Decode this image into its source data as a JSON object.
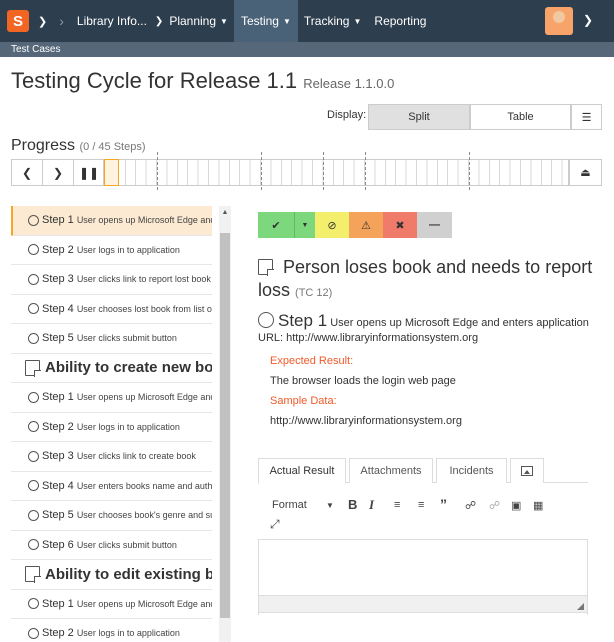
{
  "nav": {
    "logo": "S",
    "items": [
      {
        "label": "Library Info..."
      },
      {
        "label": "Planning"
      },
      {
        "label": "Testing"
      },
      {
        "label": "Tracking"
      },
      {
        "label": "Reporting"
      }
    ]
  },
  "breadcrumb": "Test Cases",
  "page": {
    "title": "Testing Cycle for Release 1.1",
    "release": "Release 1.1.0.0"
  },
  "display": {
    "label": "Display:",
    "split": "Split",
    "table": "Table"
  },
  "progress": {
    "title": "Progress",
    "counter": "(0 / 45 Steps)",
    "completed": 0,
    "total": 45
  },
  "steps_list": [
    {
      "type": "step",
      "name": "Step 1",
      "desc": "User opens up Microsoft Edge and enters application URL",
      "active": true
    },
    {
      "type": "step",
      "name": "Step 2",
      "desc": "User logs in to application"
    },
    {
      "type": "step",
      "name": "Step 3",
      "desc": "User clicks link to report lost book"
    },
    {
      "type": "step",
      "name": "Step 4",
      "desc": "User chooses lost book from list of books"
    },
    {
      "type": "step",
      "name": "Step 5",
      "desc": "User clicks submit button"
    },
    {
      "type": "case",
      "name": "Ability to create new book"
    },
    {
      "type": "step",
      "name": "Step 1",
      "desc": "User opens up Microsoft Edge and enters application URL"
    },
    {
      "type": "step",
      "name": "Step 2",
      "desc": "User logs in to application"
    },
    {
      "type": "step",
      "name": "Step 3",
      "desc": "User clicks link to create book"
    },
    {
      "type": "step",
      "name": "Step 4",
      "desc": "User enters books name and author"
    },
    {
      "type": "step",
      "name": "Step 5",
      "desc": "User chooses book's genre and subject"
    },
    {
      "type": "step",
      "name": "Step 6",
      "desc": "User clicks submit button"
    },
    {
      "type": "case",
      "name": "Ability to edit existing book"
    },
    {
      "type": "step",
      "name": "Step 1",
      "desc": "User opens up Microsoft Edge and enters application URL"
    },
    {
      "type": "step",
      "name": "Step 2",
      "desc": "User logs in to application"
    }
  ],
  "detail": {
    "case_title": "Person loses book and needs to report loss",
    "case_id": "(TC 12)",
    "step_name": "Step 1",
    "step_desc": "User opens up Microsoft Edge and enters application URL: http://www.libraryinformationsystem.org",
    "expected_label": "Expected Result:",
    "expected_value": "The browser loads the login web page",
    "sample_label": "Sample Data:",
    "sample_value": "http://www.libraryinformationsystem.org"
  },
  "tabs": {
    "actual": "Actual Result",
    "attachments": "Attachments",
    "incidents": "Incidents"
  },
  "editor": {
    "format_label": "Format"
  }
}
